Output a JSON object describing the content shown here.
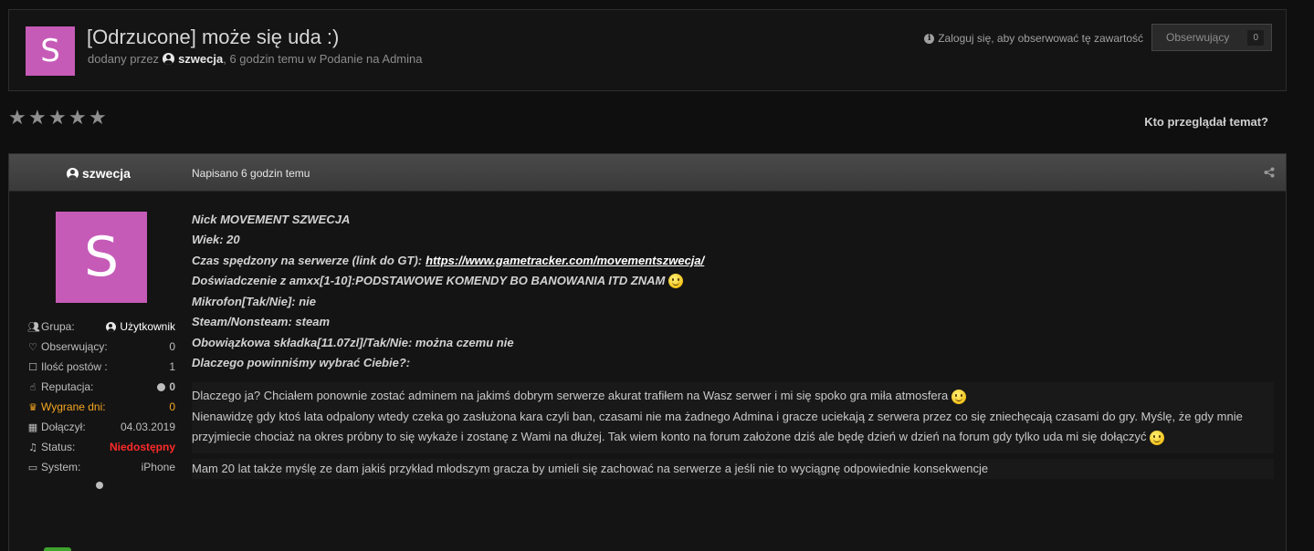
{
  "topic": {
    "avatar_letter": "S",
    "title": "[Odrzucone] może się uda :)",
    "meta_prefix": "dodany przez",
    "author": "szwecja",
    "meta_suffix": ", 6 godzin temu w Podanie na Admina",
    "login_hint": "Zaloguj się, aby obserwować tę zawartość",
    "follow_label": "Obserwujący",
    "follow_count": "0"
  },
  "rating": {
    "stars": 5,
    "filled": 0
  },
  "who_viewed": "Kto przeglądał temat?",
  "post": {
    "author": "szwecja",
    "date": "Napisano 6 godzin temu",
    "avatar_letter": "S",
    "stats": [
      {
        "key": "Grupa:",
        "value": "Użytkownik",
        "icon": "group-icon"
      },
      {
        "key": "Obserwujący:",
        "value": "0",
        "icon": "heart-icon"
      },
      {
        "key": "Ilość postów :",
        "value": "1",
        "icon": "posts-icon"
      },
      {
        "key": "Reputacja:",
        "value": "0",
        "icon": "thumbs-up-icon"
      },
      {
        "key": "Wygrane dni:",
        "value": "0",
        "icon": "trophy-icon"
      },
      {
        "key": "Dołączył:",
        "value": "04.03.2019",
        "icon": "calendar-icon"
      },
      {
        "key": "Status:",
        "value": "Niedostępny",
        "icon": "bell-icon"
      },
      {
        "key": "System:",
        "value": "iPhone",
        "icon": "laptop-icon"
      }
    ],
    "questions": [
      {
        "text": "Nick MOVEMENT SZWECJA"
      },
      {
        "text": "Wiek: 20"
      },
      {
        "text": "Czas spędzony na serwerze (link do GT):",
        "link": "https://www.gametracker.com/movementszwecja/"
      },
      {
        "text": "Doświadczenie z amxx[1-10]:PODSTAWOWE KOMENDY BO BANOWANIA ITD ZNAM"
      },
      {
        "text": "Mikrofon[Tak/Nie]: nie"
      },
      {
        "text": "Steam/Nonsteam:  steam"
      },
      {
        "text": "Obowiązkowa składka[11.07zl]/Tak/Nie: można czemu nie"
      },
      {
        "text": "Dlaczego powinniśmy wybrać Ciebie?:"
      }
    ],
    "answer_line1": "Dlaczego ja? Chciałem ponownie zostać adminem na jakimś dobrym serwerze akurat trafiłem na Wasz serwer i mi się spoko gra miła atmosfera",
    "answer_line2": "Nienawidzę gdy ktoś lata odpalony wtedy czeka go zasłużona kara czyli ban, czasami nie ma żadnego Admina i gracze uciekają z serwera przez co się zniechęcają czasami do gry. Myślę, że gdy mnie przyjmiecie chociaż na okres próbny to się wykaże i zostanę z Wami na dłużej. Tak wiem konto na forum założone dziś ale będę dzień w dzień na forum gdy tylko uda mi się dołączyć",
    "answer_line3": "Mam 20 lat także myślę ze dam jakiś przykład młodszym gracza by umieli się zachować na serwerze a jeśli nie to wyciągnę odpowiednie konsekwencje"
  }
}
